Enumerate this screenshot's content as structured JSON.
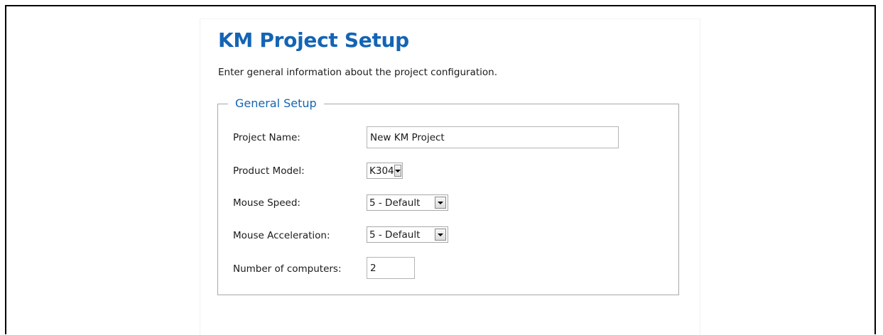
{
  "header": {
    "title": "KM Project Setup",
    "subtitle": "Enter general information about the project configuration."
  },
  "general_setup": {
    "legend": "General Setup",
    "project_name": {
      "label": "Project Name:",
      "value": "New KM Project"
    },
    "product_model": {
      "label": "Product Model:",
      "value": "K304"
    },
    "mouse_speed": {
      "label": "Mouse Speed:",
      "value": "5 - Default"
    },
    "mouse_acceleration": {
      "label": "Mouse Acceleration:",
      "value": "5 - Default"
    },
    "number_of_computers": {
      "label": "Number of computers:",
      "value": "2"
    }
  },
  "icons": {
    "dropdown": "chevron-down-icon"
  },
  "colors": {
    "accent": "#1464b4",
    "border": "#a8a8a8"
  }
}
